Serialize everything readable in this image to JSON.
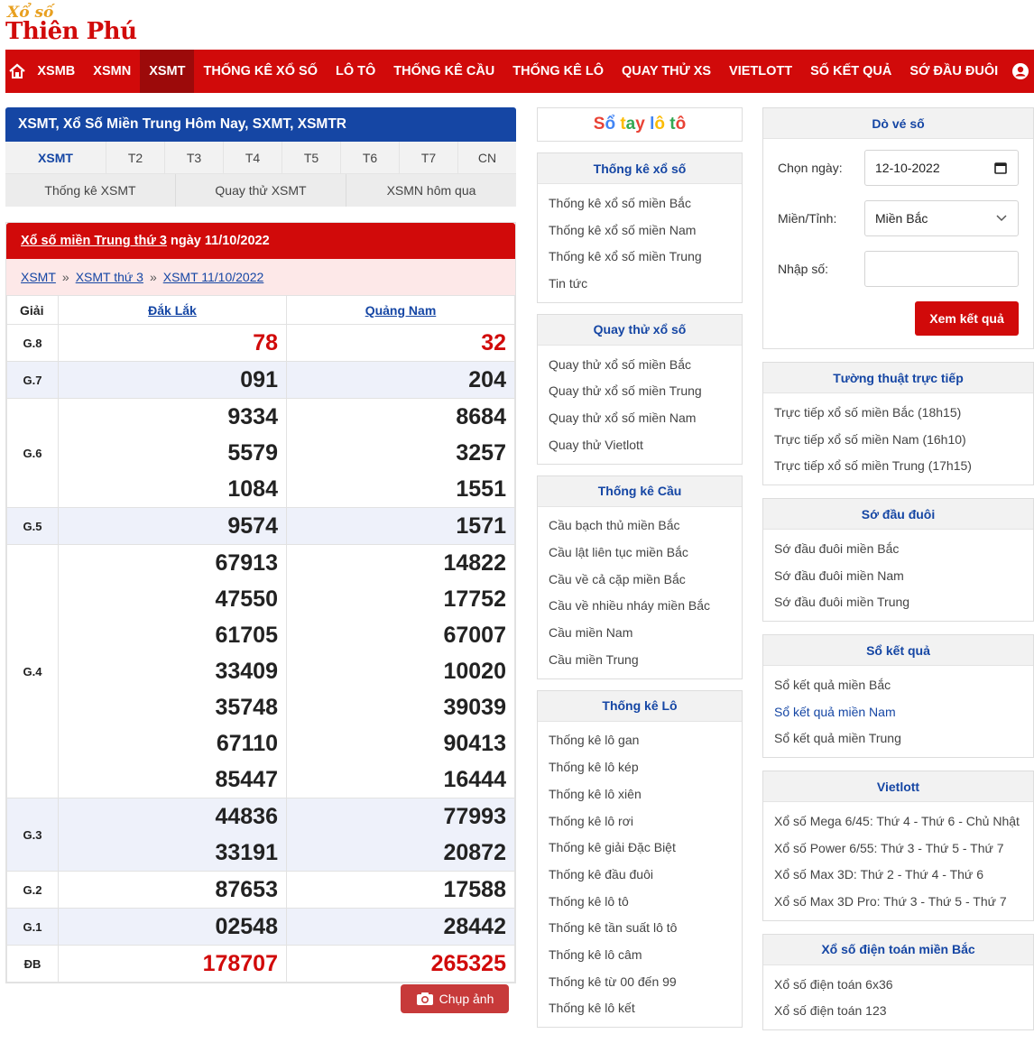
{
  "brand": {
    "line1": "Xổ số",
    "line2": "Thiên Phú"
  },
  "nav": [
    {
      "label": "XSMB"
    },
    {
      "label": "XSMN"
    },
    {
      "label": "XSMT",
      "active": true
    },
    {
      "label": "THỐNG KÊ XỔ SỐ"
    },
    {
      "label": "LÔ TÔ"
    },
    {
      "label": "THỐNG KÊ CẦU"
    },
    {
      "label": "THỐNG KÊ LÔ"
    },
    {
      "label": "QUAY THỬ XS"
    },
    {
      "label": "VIETLOTT"
    },
    {
      "label": "SỐ KẾT QUẢ"
    },
    {
      "label": "SỚ ĐẦU ĐUÔI"
    }
  ],
  "header_title": "XSMT, Xổ Số Miền Trung Hôm Nay, SXMT, XSMTR",
  "day_tabs": [
    "XSMT",
    "T2",
    "T3",
    "T4",
    "T5",
    "T6",
    "T7",
    "CN"
  ],
  "sub_tabs": [
    "Thống kê XSMT",
    "Quay thử XSMT",
    "XSMN hôm qua"
  ],
  "result": {
    "title_link": "Xổ số miền Trung thứ 3",
    "title_rest": " ngày 11/10/2022",
    "breadcrumb": [
      "XSMT",
      "XSMT thứ 3",
      "XSMT 11/10/2022"
    ],
    "breadcrumb_sep": "»",
    "col_giai": "Giải",
    "provinces": [
      "Đắk Lắk",
      "Quảng Nam"
    ],
    "prizes": [
      {
        "label": "G.8",
        "a": [
          "78"
        ],
        "b": [
          "32"
        ],
        "red": true
      },
      {
        "label": "G.7",
        "a": [
          "091"
        ],
        "b": [
          "204"
        ]
      },
      {
        "label": "G.6",
        "a": [
          "9334",
          "5579",
          "1084"
        ],
        "b": [
          "8684",
          "3257",
          "1551"
        ]
      },
      {
        "label": "G.5",
        "a": [
          "9574"
        ],
        "b": [
          "1571"
        ]
      },
      {
        "label": "G.4",
        "a": [
          "67913",
          "47550",
          "61705",
          "33409",
          "35748",
          "67110",
          "85447"
        ],
        "b": [
          "14822",
          "17752",
          "67007",
          "10020",
          "39039",
          "90413",
          "16444"
        ]
      },
      {
        "label": "G.3",
        "a": [
          "44836",
          "33191"
        ],
        "b": [
          "77993",
          "20872"
        ]
      },
      {
        "label": "G.2",
        "a": [
          "87653"
        ],
        "b": [
          "17588"
        ]
      },
      {
        "label": "G.1",
        "a": [
          "02548"
        ],
        "b": [
          "28442"
        ]
      },
      {
        "label": "ĐB",
        "a": [
          "178707"
        ],
        "b": [
          "265325"
        ],
        "red": true
      }
    ],
    "camera_label": "Chụp ảnh"
  },
  "notebook": {
    "letters": [
      {
        "ch": "S",
        "color": "#e94235"
      },
      {
        "ch": "ổ",
        "color": "#4285f4"
      },
      {
        "ch": " ",
        "color": "#333"
      },
      {
        "ch": "t",
        "color": "#fbbc05"
      },
      {
        "ch": "a",
        "color": "#34a853"
      },
      {
        "ch": "y",
        "color": "#e94235"
      },
      {
        "ch": " ",
        "color": "#333"
      },
      {
        "ch": "l",
        "color": "#4285f4"
      },
      {
        "ch": "ô",
        "color": "#fbbc05"
      },
      {
        "ch": " ",
        "color": "#333"
      },
      {
        "ch": "t",
        "color": "#34a853"
      },
      {
        "ch": "ô",
        "color": "#e94235"
      }
    ]
  },
  "mid_panels": [
    {
      "title": "Thống kê xổ số",
      "items": [
        "Thống kê xổ số miền Bắc",
        "Thống kê xổ số miền Nam",
        "Thống kê xổ số miền Trung",
        "Tin tức"
      ]
    },
    {
      "title": "Quay thử xổ số",
      "items": [
        "Quay thử xổ số miền Bắc",
        "Quay thử xổ số miền Trung",
        "Quay thử xổ số miền Nam",
        "Quay thử Vietlott"
      ]
    },
    {
      "title": "Thống kê Cầu",
      "items": [
        "Cầu bạch thủ miền Bắc",
        "Cầu lật liên tục miền Bắc",
        "Cầu về cả cặp miền Bắc",
        "Cầu về nhiều nháy miền Bắc",
        "Cầu miền Nam",
        "Cầu miền Trung"
      ]
    },
    {
      "title": "Thống kê Lô",
      "items": [
        "Thống kê lô gan",
        "Thống kê lô kép",
        "Thống kê lô xiên",
        "Thống kê lô rơi",
        "Thống kê giải Đặc Biệt",
        "Thống kê đầu đuôi",
        "Thống kê lô tô",
        "Thống kê tần suất lô tô",
        "Thống kê lô câm",
        "Thống kê từ 00 đến 99",
        "Thống kê lô kết"
      ]
    }
  ],
  "ticket": {
    "title": "Dò vé số",
    "date_label": "Chọn ngày:",
    "date_value": "12-10-2022",
    "region_label": "Miền/Tỉnh:",
    "region_value": "Miền Bắc",
    "number_label": "Nhập số:",
    "number_value": "",
    "submit": "Xem kết quả"
  },
  "right_panels": [
    {
      "title": "Tường thuật trực tiếp",
      "items": [
        "Trực tiếp xổ số miền Bắc (18h15)",
        "Trực tiếp xổ số miền Nam (16h10)",
        "Trực tiếp xổ số miền Trung (17h15)"
      ]
    },
    {
      "title": "Sớ đầu đuôi",
      "items": [
        "Sớ đầu đuôi miền Bắc",
        "Sớ đầu đuôi miền Nam",
        "Sớ đầu đuôi miền Trung"
      ]
    },
    {
      "title": "Sổ kết quả",
      "items": [
        "Sổ kết quả miền Bắc",
        "Sổ kết quả miền Nam",
        "Sổ kết quả miền Trung"
      ],
      "highlight_index": 1
    },
    {
      "title": "Vietlott",
      "items": [
        "Xổ số Mega 6/45: Thứ 4 - Thứ 6 - Chủ Nhật",
        "Xổ số Power 6/55: Thứ 3 - Thứ 5 - Thứ 7",
        "Xổ số Max 3D: Thứ 2 - Thứ 4 - Thứ 6",
        "Xổ số Max 3D Pro: Thứ 3 - Thứ 5 - Thứ 7"
      ]
    },
    {
      "title": "Xổ số điện toán miền Bắc",
      "items": [
        "Xổ số điện toán 6x36",
        "Xổ số điện toán 123"
      ]
    }
  ],
  "icons": {
    "home": "home-icon",
    "user": "user-icon",
    "camera": "camera-icon",
    "calendar": "calendar-icon",
    "chevron": "chevron-down-icon"
  }
}
